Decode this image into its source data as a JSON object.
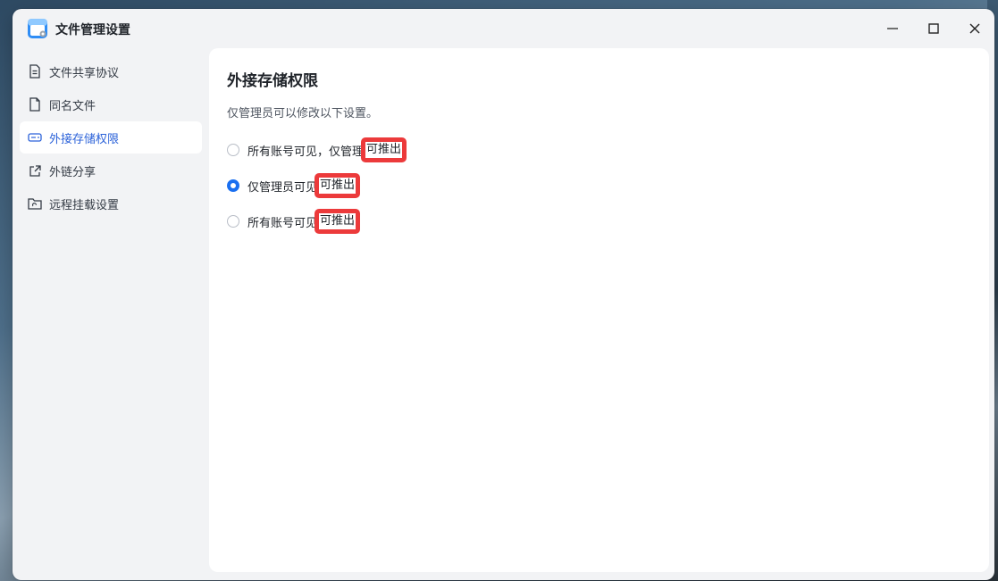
{
  "window": {
    "title": "文件管理设置",
    "accent": "#2b62d9"
  },
  "controls": {
    "minimize": "minimize-icon",
    "maximize": "maximize-icon",
    "close": "close-icon"
  },
  "sidebar": {
    "items": [
      {
        "label": "文件共享协议",
        "icon": "document-icon",
        "active": false
      },
      {
        "label": "同名文件",
        "icon": "file-icon",
        "active": false
      },
      {
        "label": "外接存储权限",
        "icon": "drive-icon",
        "active": true
      },
      {
        "label": "外链分享",
        "icon": "share-icon",
        "active": false
      },
      {
        "label": "远程挂载设置",
        "icon": "folder-mount-icon",
        "active": false
      }
    ]
  },
  "main": {
    "title": "外接存储权限",
    "description": "仅管理员可以修改以下设置。",
    "options": [
      {
        "text": "所有账号可见，仅管理",
        "highlight": "可推出",
        "checked": false
      },
      {
        "text": "仅管理员可见",
        "highlight": "可推出",
        "checked": true
      },
      {
        "text": "所有账号可见",
        "highlight": "可推出",
        "checked": false
      }
    ],
    "highlight_color": "#ec3a3b",
    "radio_color": "#1a6ff0"
  }
}
